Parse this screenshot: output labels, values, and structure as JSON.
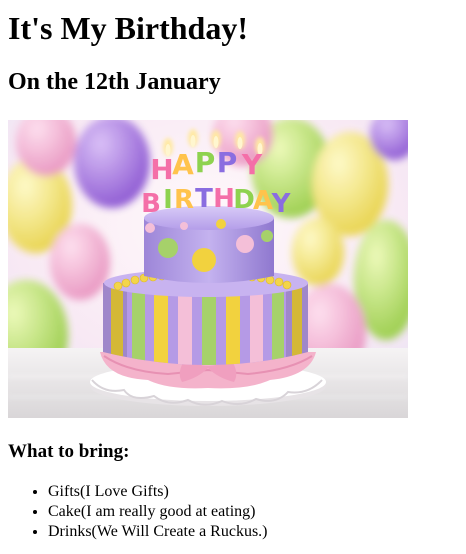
{
  "page": {
    "title": "It's My Birthday!",
    "subtitle": "On the 12th January",
    "bring_heading": "What to bring:",
    "bring_items": [
      "Gifts(I Love Gifts)",
      "Cake(I am really good at eating)",
      "Drinks(We Will Create a Ruckus.)"
    ]
  },
  "image": {
    "candle_text_line1": "HAPPY",
    "candle_text_line2": "BIRTHDAY",
    "subject": "birthday-cake-with-balloons"
  },
  "colors": {
    "cake_purple": "#b39ae6",
    "cake_yellow": "#f2d23e",
    "cake_green": "#a6d16a",
    "cake_pink": "#f4bfd8",
    "ribbon_pink": "#f7b8cf",
    "balloon_purple": "#9a63d9",
    "balloon_yellow": "#f2e05a",
    "balloon_green": "#b8dc62",
    "balloon_pink": "#f0a8cc"
  }
}
